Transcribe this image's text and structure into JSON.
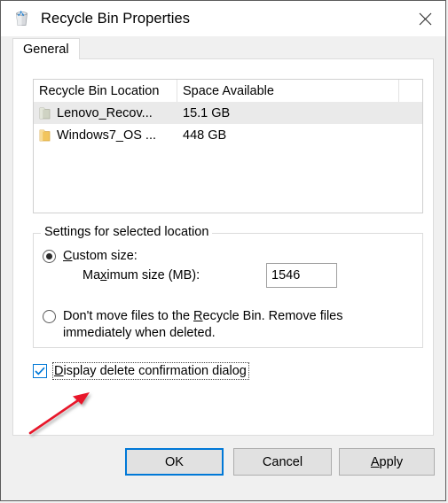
{
  "window": {
    "title": "Recycle Bin Properties",
    "icon": "recycle-bin-icon",
    "close_label": "✕"
  },
  "tabs": [
    {
      "label": "General",
      "active": true
    }
  ],
  "list": {
    "columns": [
      "Recycle Bin Location",
      "Space Available"
    ],
    "rows": [
      {
        "name": "Lenovo_Recov...",
        "space": "15.1 GB",
        "selected": true,
        "icon": "drive-icon-green"
      },
      {
        "name": "Windows7_OS ...",
        "space": "448 GB",
        "selected": false,
        "icon": "drive-icon-yellow"
      }
    ]
  },
  "settings": {
    "legend": "Settings for selected location",
    "custom_size": {
      "label_pre": "",
      "accel": "C",
      "label_post": "ustom size:",
      "selected": true
    },
    "maximum_size": {
      "label_pre": "Ma",
      "accel": "x",
      "label_post": "imum size (MB):",
      "value": "1546"
    },
    "dont_move": {
      "line1_pre": "Don't move files to the ",
      "line1_accel": "R",
      "line1_post": "ecycle Bin. Remove files",
      "line2": "immediately when deleted.",
      "selected": false
    }
  },
  "display_confirmation": {
    "accel": "D",
    "label_post": "isplay delete confirmation dialog",
    "checked": true,
    "focused": true
  },
  "buttons": {
    "ok": "OK",
    "cancel": "Cancel",
    "apply_accel": "A",
    "apply_post": "pply"
  },
  "colors": {
    "accent": "#0078d7",
    "annotation": "#e8192c",
    "selection": "#eaeaea"
  }
}
